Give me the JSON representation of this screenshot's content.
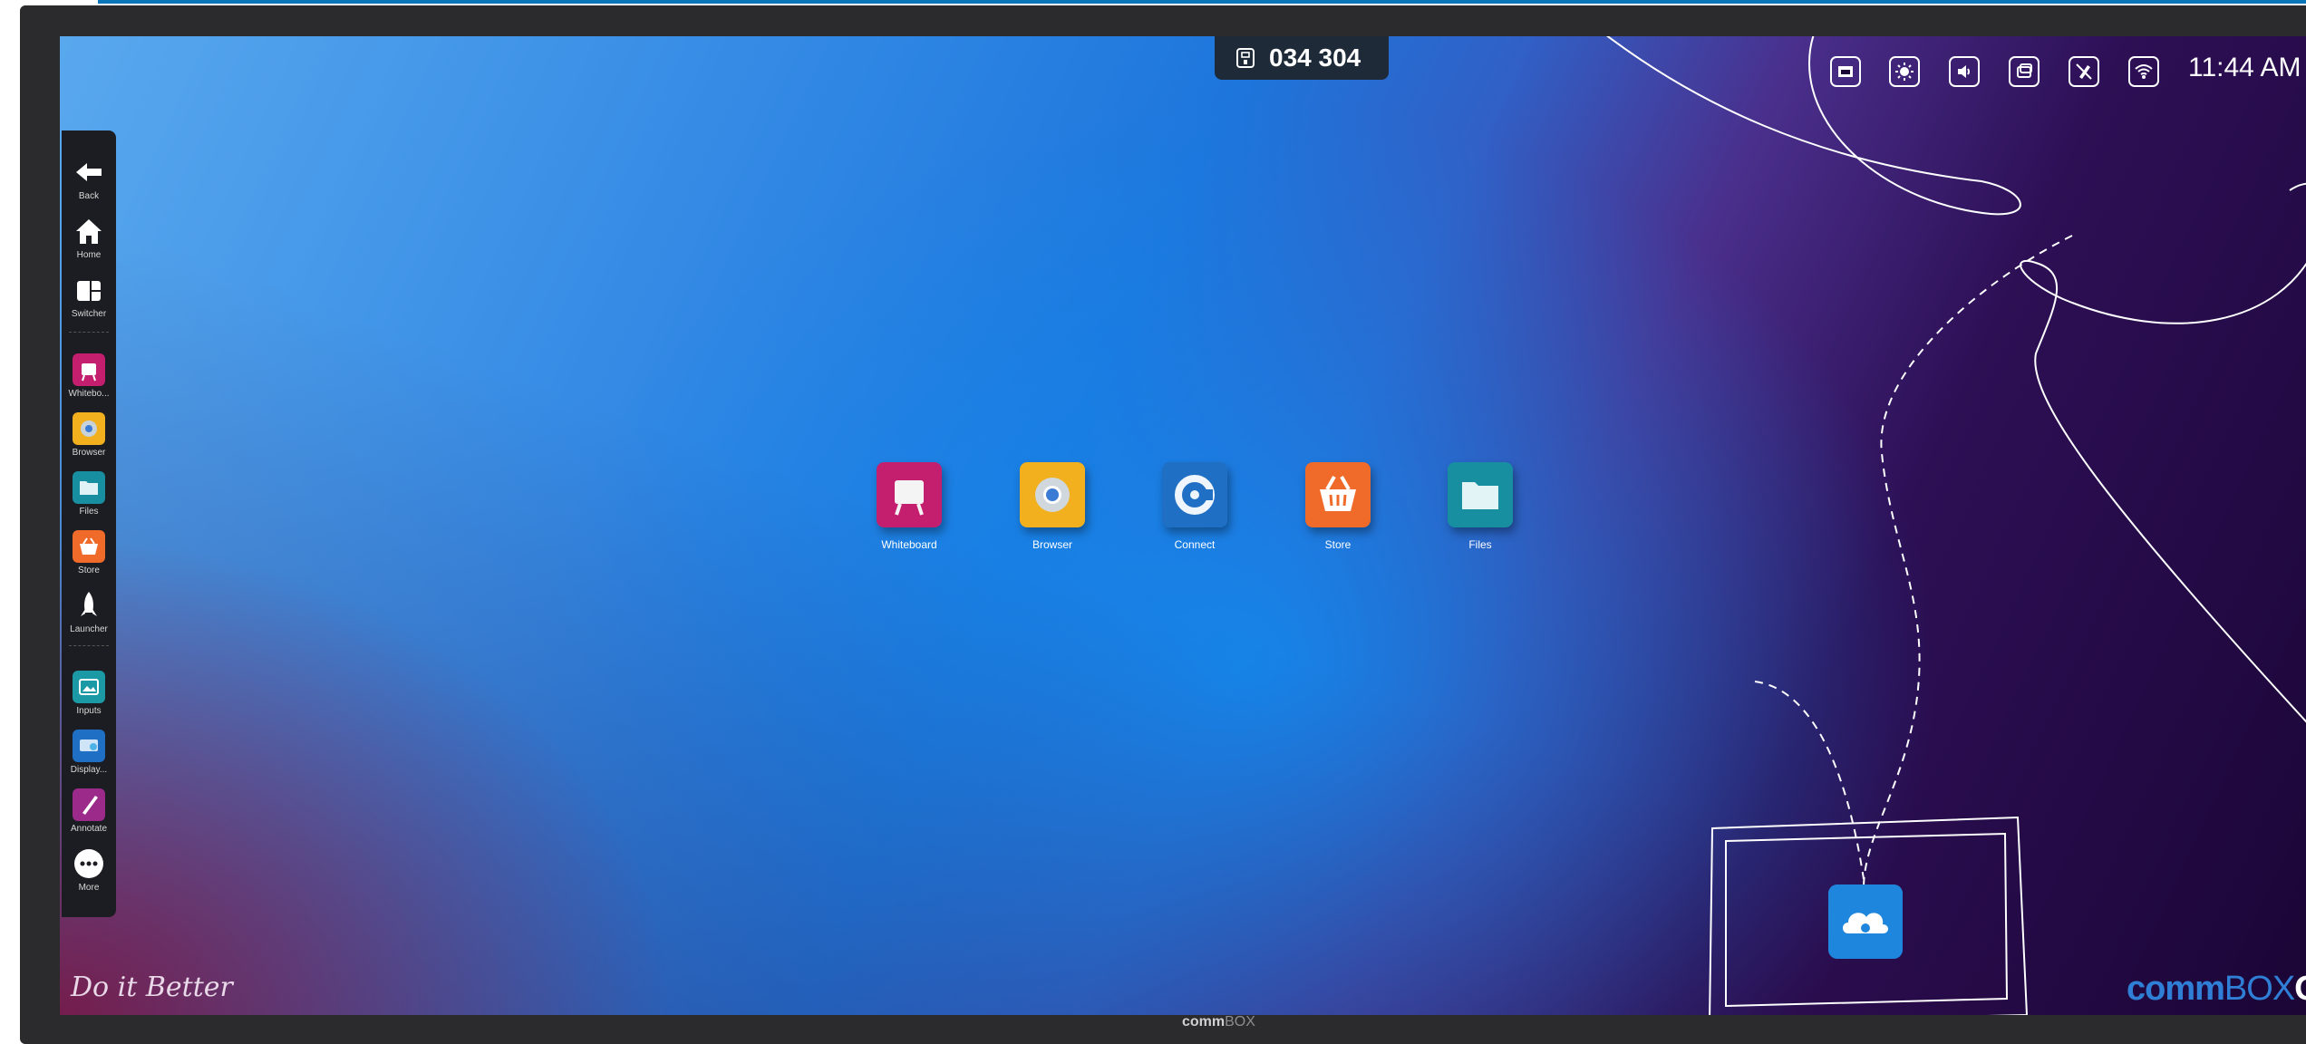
{
  "header": {
    "meeting_code": "034 304",
    "clock": "11:44 AM",
    "status_icons": [
      "input-source-icon",
      "brightness-icon",
      "volume-icon",
      "screen-mirror-icon",
      "pen-off-icon",
      "wifi-icon"
    ]
  },
  "sidebar": {
    "items": [
      {
        "label": "Back",
        "icon": "back-arrow-icon"
      },
      {
        "label": "Home",
        "icon": "home-icon"
      },
      {
        "label": "Switcher",
        "icon": "switcher-icon"
      },
      {
        "label": "Whitebo...",
        "icon": "whiteboard-icon"
      },
      {
        "label": "Browser",
        "icon": "browser-icon"
      },
      {
        "label": "Files",
        "icon": "files-icon"
      },
      {
        "label": "Store",
        "icon": "store-icon"
      },
      {
        "label": "Launcher",
        "icon": "rocket-icon"
      },
      {
        "label": "Inputs",
        "icon": "inputs-icon"
      },
      {
        "label": "Display...",
        "icon": "display-icon"
      },
      {
        "label": "Annotate",
        "icon": "annotate-icon"
      },
      {
        "label": "More",
        "icon": "more-icon"
      }
    ]
  },
  "desktop": {
    "apps": [
      {
        "label": "Whiteboard",
        "icon": "whiteboard-icon",
        "color": "#c41e6e"
      },
      {
        "label": "Browser",
        "icon": "chrome-icon",
        "color": "#f2b01e"
      },
      {
        "label": "Connect",
        "icon": "connect-icon",
        "color": "#1f6fc4"
      },
      {
        "label": "Store",
        "icon": "basket-icon",
        "color": "#f06a2a"
      },
      {
        "label": "Files",
        "icon": "folder-icon",
        "color": "#178fa0"
      }
    ]
  },
  "branding": {
    "tagline": "Do it Better",
    "brand_bold": "comm",
    "brand_thin": "BOX",
    "brand_os": "OS",
    "bezel_bold": "comm",
    "bezel_thin": "BOX"
  }
}
